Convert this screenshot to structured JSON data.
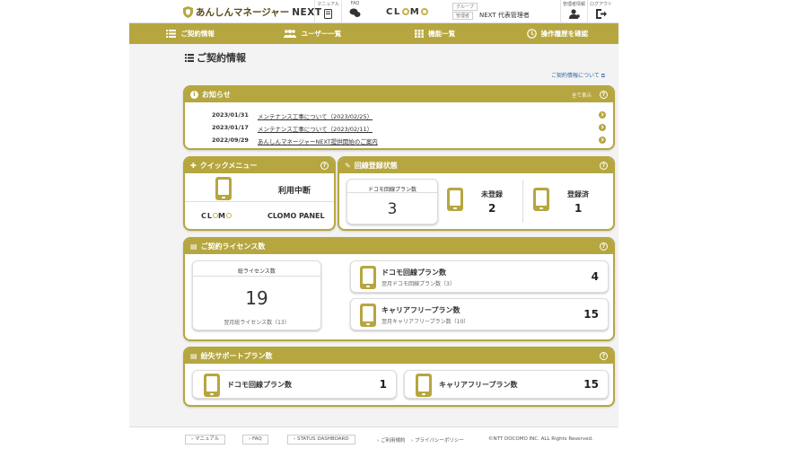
{
  "header": {
    "app_name": "あんしんマネージャー",
    "app_name_suffix": "NEXT",
    "manual_label": "マニュアル",
    "faq_label": "FAQ",
    "clomo_logo": "CLOMO",
    "group_label": "グループ",
    "role_label": "管理者",
    "user_name": "NEXT 代表管理者",
    "admin_info_label": "管理者情報",
    "logout_label": "ログアウト"
  },
  "nav": {
    "items": [
      {
        "label": "ご契約情報"
      },
      {
        "label": "ユーザー一覧"
      },
      {
        "label": "機能一覧"
      },
      {
        "label": "操作履歴を確認"
      }
    ]
  },
  "page": {
    "title": "ご契約情報",
    "contract_link": "ご契約情報について"
  },
  "news": {
    "title": "お知らせ",
    "show_all": "全て表示",
    "items": [
      {
        "date": "2023/01/31",
        "title": "メンテナンス工事について（2023/02/25）"
      },
      {
        "date": "2023/01/17",
        "title": "メンテナンス工事について（2023/02/11）"
      },
      {
        "date": "2022/09/29",
        "title": "あんしんマネージャーNEXT提供開始のご案内"
      }
    ]
  },
  "quick_menu": {
    "title": "クイックメニュー",
    "suspend_label": "利用中断",
    "clomo_panel_label": "CLOMO PANEL",
    "clomo_logo": "CLOMO"
  },
  "registration": {
    "title": "回線登録状態",
    "docomo_plan_label": "ドコモ回線プラン数",
    "docomo_plan_count": "3",
    "unregistered_label": "未登録",
    "unregistered_count": "2",
    "registered_label": "登録済",
    "registered_count": "1"
  },
  "license": {
    "title": "ご契約ライセンス数",
    "total_label": "総ライセンス数",
    "total_count": "19",
    "next_month_total": "翌月総ライセンス数（13）",
    "docomo_label": "ドコモ回線プラン数",
    "docomo_next": "翌月ドコモ回線プラン数（3）",
    "docomo_count": "4",
    "carrier_free_label": "キャリアフリープラン数",
    "carrier_free_next": "翌月キャリアフリープラン数（10）",
    "carrier_free_count": "15"
  },
  "lost_support": {
    "title": "紛失サポートプラン数",
    "docomo_label": "ドコモ回線プラン数",
    "docomo_count": "1",
    "carrier_free_label": "キャリアフリープラン数",
    "carrier_free_count": "15"
  },
  "footer": {
    "manual": "› マニュアル",
    "faq": "› FAQ",
    "status": "› STATUS DASHBOARD",
    "terms": "› ご利用規約",
    "privacy": "› プライバシーポリシー",
    "copyright": "©NTT DOCOMO INC. ALL Rights Reserved."
  },
  "colors": {
    "accent": "#b6a640",
    "background": "#f3f3f3"
  }
}
